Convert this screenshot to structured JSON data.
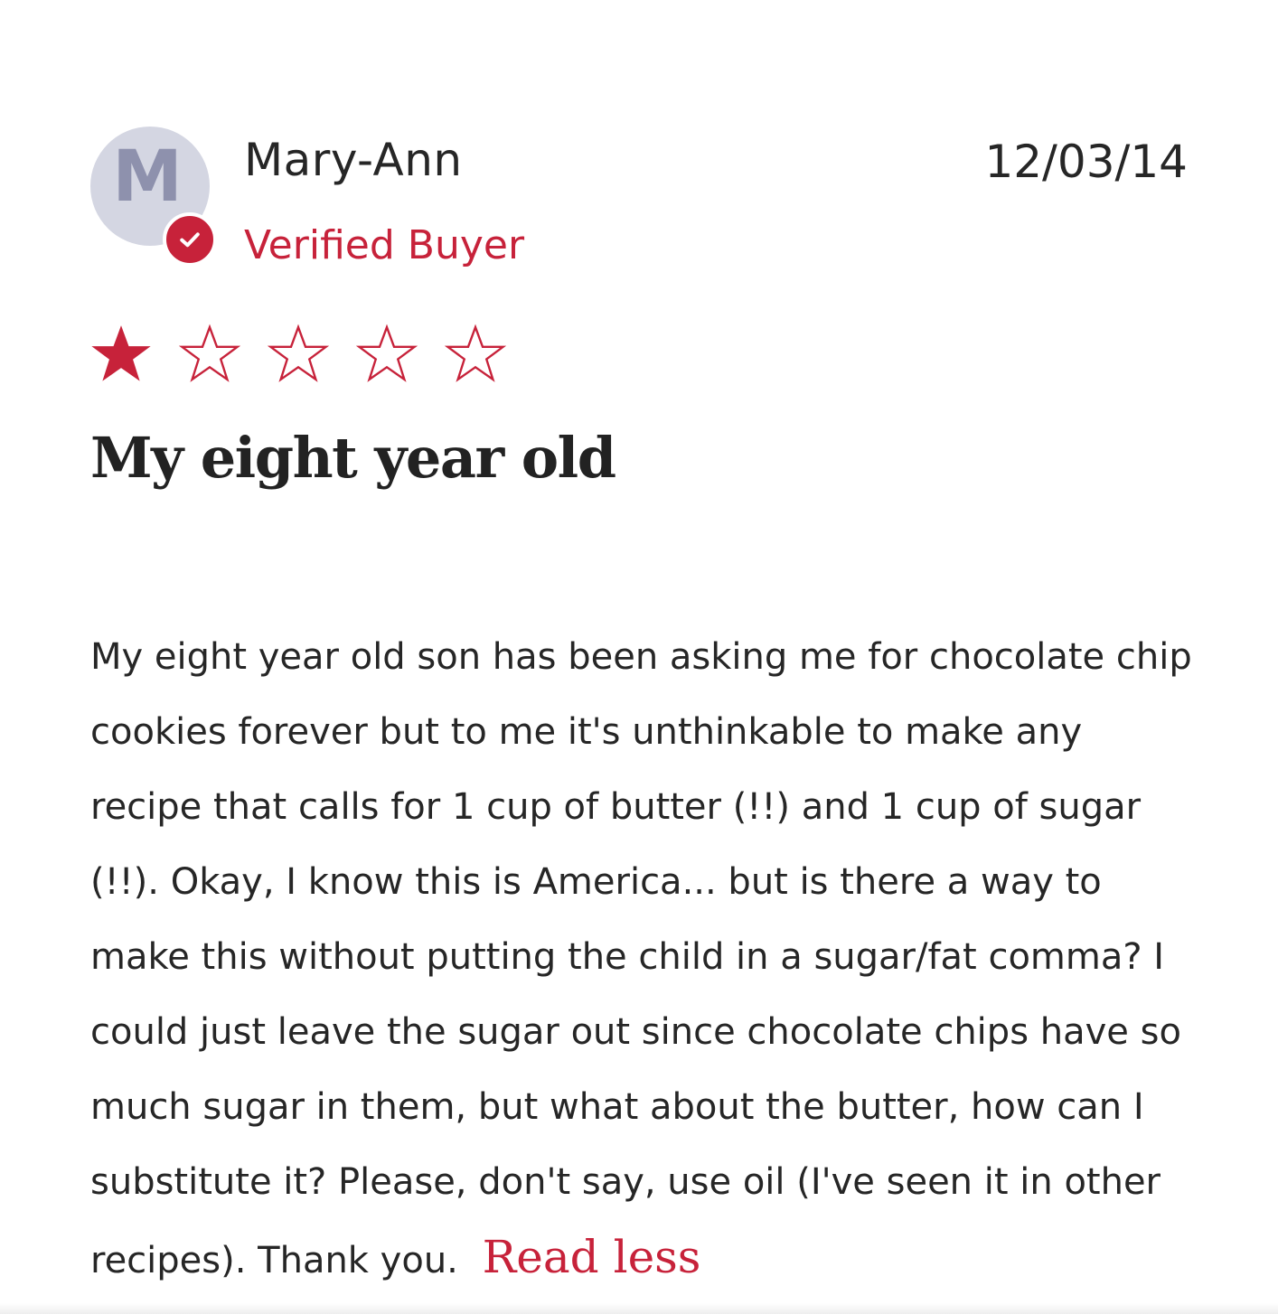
{
  "review": {
    "avatar_letter": "M",
    "author": "Mary-Ann",
    "verified_label": "Verified Buyer",
    "date": "12/03/14",
    "rating": 1,
    "rating_max": 5,
    "title": "My eight year old",
    "body": "My eight year old son has been asking me for chocolate chip cookies forever but to me it's unthinkable to make any recipe that calls for 1 cup of butter (!!) and 1 cup of sugar (!!). Okay, I know this is America... but is there a way to make this without putting the child in a sugar/fat comma? I could just leave the sugar out since chocolate chips have so much sugar in them, but what about the butter, how can I substitute it? Please, don't say, use oil (I've seen it in other recipes). Thank you.",
    "read_less_label": "Read less"
  },
  "colors": {
    "accent": "#c7223a",
    "avatar_bg": "#d4d6e2",
    "avatar_letter": "#8e91ad",
    "text": "#262626"
  },
  "icons": {
    "verified": "check-circle-icon",
    "star_filled": "star-filled-icon",
    "star_empty": "star-outline-icon"
  }
}
